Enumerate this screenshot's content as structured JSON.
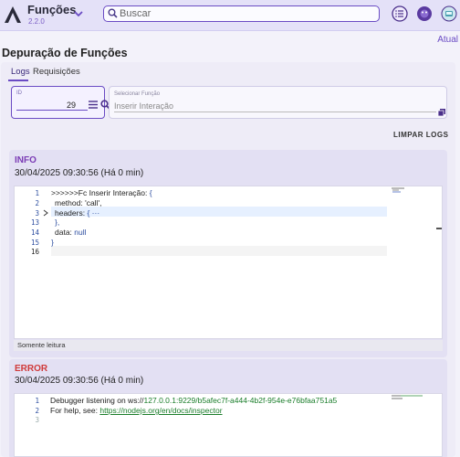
{
  "app": {
    "title": "Funções",
    "version": "2.2.0"
  },
  "search": {
    "placeholder": "Buscar"
  },
  "header": {
    "update_link": "Atual",
    "page_title": "Depuração de Funções"
  },
  "tabs": [
    {
      "label": "Logs",
      "active": true
    },
    {
      "label": "Requisições",
      "active": false
    }
  ],
  "filters": {
    "id_label": "ID",
    "id_value": "29",
    "function_label": "Selecionar Função",
    "function_value": "Inserir Interação"
  },
  "clear_button": "LIMPAR LOGS",
  "logs": [
    {
      "level": "INFO",
      "level_color": "#7b3bb5",
      "timestamp": "30/04/2025 09:30:56 (Há 0 min)",
      "line_numbers": [
        "1",
        "2",
        "3",
        "13",
        "14",
        "15",
        "16"
      ],
      "lines": [
        {
          "text": ">>>>>>Fc Inserir Interação: ",
          "brace": "{"
        },
        {
          "key": "method: ",
          "value": "'call',"
        },
        {
          "key": "headers: ",
          "value": "{ ··· "
        },
        {
          "text": "},"
        },
        {
          "key": "data: ",
          "value": "null"
        },
        {
          "text": "}"
        },
        {
          "text": ""
        }
      ],
      "footer": "Somente leitura"
    },
    {
      "level": "ERROR",
      "level_color": "#d03a3a",
      "timestamp": "30/04/2025 09:30:56 (Há 0 min)",
      "line_numbers": [
        "1",
        "2",
        "3"
      ],
      "lines": [
        {
          "text": "Debugger listening on ws://",
          "link": "127.0.0.1:9229/b5afec7f-a444-4b2f-954e-e76bfaa751a5"
        },
        {
          "text": "For help, see: ",
          "link": "https://nodejs.org/en/docs/inspector"
        },
        {
          "text": ""
        }
      ]
    }
  ],
  "icons": {
    "logo": "triangle-logo",
    "chevron": "chevron-down-icon",
    "search": "search-icon",
    "list": "list-icon",
    "palette": "palette-icon",
    "settings": "device-icon"
  },
  "colors": {
    "accent": "#6a4bc4",
    "info": "#7b3bb5",
    "error": "#d03a3a"
  }
}
